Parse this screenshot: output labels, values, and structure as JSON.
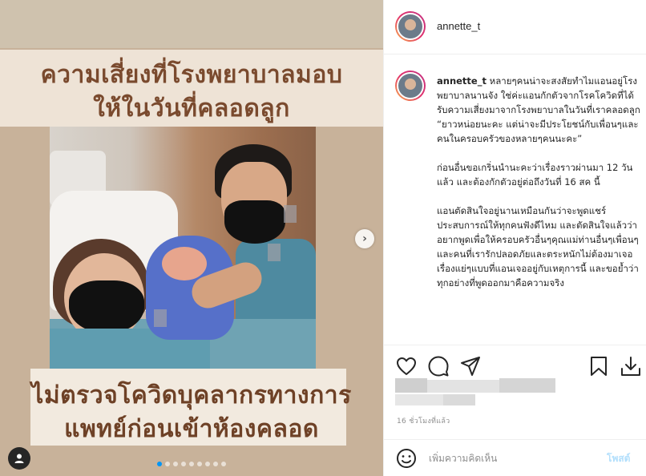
{
  "media": {
    "headline_top_line1": "ความเสี่ยงที่โรงพยาบาลมอบ",
    "headline_top_line2": "ให้ในวันที่คลอดลูก",
    "headline_bottom_line1": "ไม่ตรวจโควิดบุคลากรทางการ",
    "headline_bottom_line2": "แพทย์ก่อนเข้าห้องคลอด",
    "next_glyph": "›",
    "tag_glyph": "👤",
    "carousel_total": 9,
    "carousel_active": 1,
    "accent_color": "#0095f6"
  },
  "post": {
    "username": "annette_t",
    "caption_user": "annette_t",
    "caption_text": " หลายๆคนน่าจะสงสัยทำไมแอนอยู่โรงพยาบาลนานจัง ใช่ค่ะแอนกักตัวจากโรคโควิดที่ได้รับความเสี่ยงมาจากโรงพยาบาลในวันที่เราคลอดลูก\n“ยาวหน่อยนะคะ แต่น่าจะมีประโยชน์กับเพื่อนๆและคนในครอบครัวของหลายๆคนนะคะ”\n\nก่อนอื่นขอเกริ่นนำนะคะว่าเรื่องราวผ่านมา 12 วันแล้ว และต้องกักตัวอยู่ต่อถึงวันที่ 16 สค นี้\n\nแอนตัดสินใจอยู่นานเหมือนกันว่าจะพูดแชร์ประสบการณ์ให้ทุกคนฟังดีไหม และตัดสินใจแล้วว่าอยากพูดเพื่อให้ครอบครัวอื่นๆคุณแม่ท่านอื่นๆเพื่อนๆและคนที่เรารักปลอดภัยและตระหนักไม่ต้องมาเจอเรื่องแย่ๆแบบที่แอนเจออยู่กับเหตุการนี้ และขอย้ำว่าทุกอย่างที่พูดออกมาคือความจริง",
    "time_ago": "16 ชั่วโมงที่แล้ว",
    "comment_placeholder": "เพิ่มความคิดเห็น",
    "post_label": "โพสต์",
    "icons": [
      "heart-icon",
      "comment-icon",
      "share-icon",
      "bookmark-icon",
      "download-icon",
      "emoji-icon"
    ]
  }
}
